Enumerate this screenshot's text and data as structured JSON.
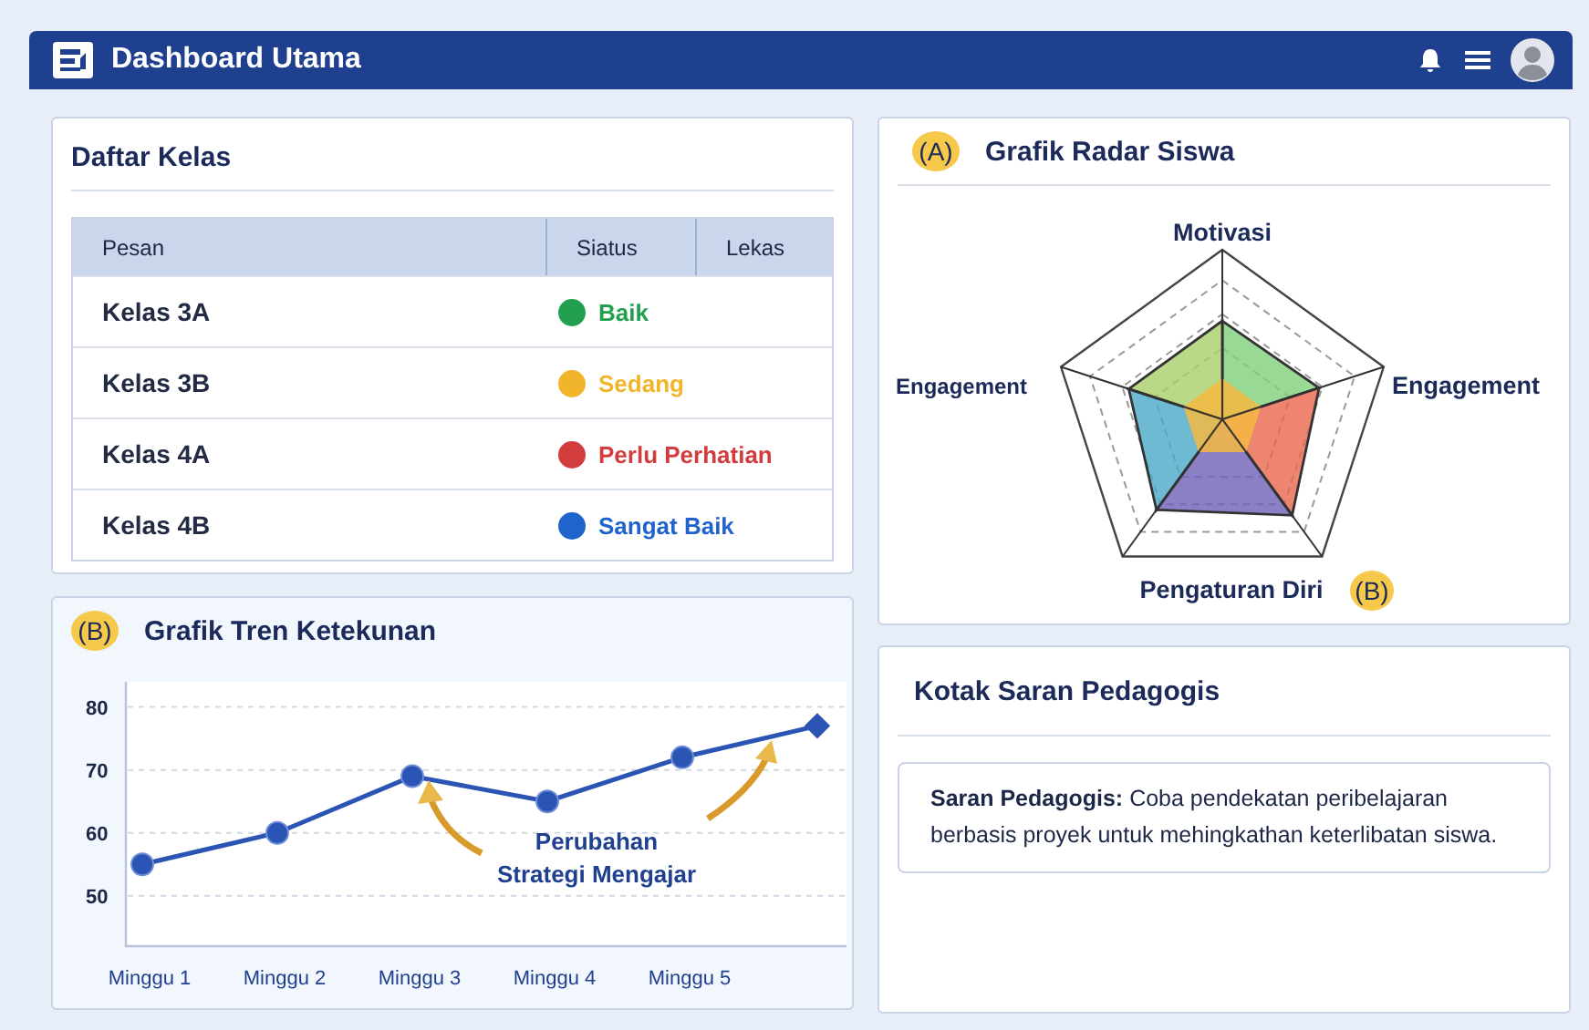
{
  "header": {
    "title": "Dashboard Utama"
  },
  "class_list": {
    "title": "Daftar Kelas",
    "columns": [
      "Pesan",
      "Siatus",
      "Lekas"
    ],
    "rows": [
      {
        "name": "Kelas 3A",
        "status": "Baik",
        "color": "#23a04f"
      },
      {
        "name": "Kelas 3B",
        "status": "Sedang",
        "color": "#f0b52a"
      },
      {
        "name": "Kelas 4A",
        "status": "Perlu Perhatian",
        "color": "#d23c3c"
      },
      {
        "name": "Kelas 4B",
        "status": "Sangat Baik",
        "color": "#1f63cc"
      }
    ]
  },
  "trend": {
    "badge": "(B)",
    "title": "Grafik Tren Ketekunan",
    "chart_data": {
      "type": "line",
      "categories": [
        "Minggu 1",
        "Minggu 2",
        "Minggu 3",
        "Minggu 4",
        "Minggu 5",
        null
      ],
      "yticks": [
        50,
        60,
        70,
        80
      ],
      "ylim": [
        42,
        84
      ],
      "grid": true,
      "series": [
        {
          "color": "#2b55b5",
          "marker": "circle",
          "values": [
            55,
            60,
            69,
            65,
            72,
            77
          ]
        }
      ],
      "annotations": [
        {
          "text": "Perubahan Strategi Mengajar"
        }
      ]
    }
  },
  "radar": {
    "badge": "(A)",
    "title": "Grafik Radar Siswa",
    "axes": [
      "Motivasi",
      "Engagement",
      "Pengaturan Diri",
      "Engagement"
    ],
    "axis_badge": "(B)"
  },
  "suggestion": {
    "title": "Kotak Saran Pedagogis",
    "text": "**Saran Pedagogis:** Coba pendekatan peribelajaran berbasis proyek untuk mehingkathan keterlibatan siswa."
  }
}
